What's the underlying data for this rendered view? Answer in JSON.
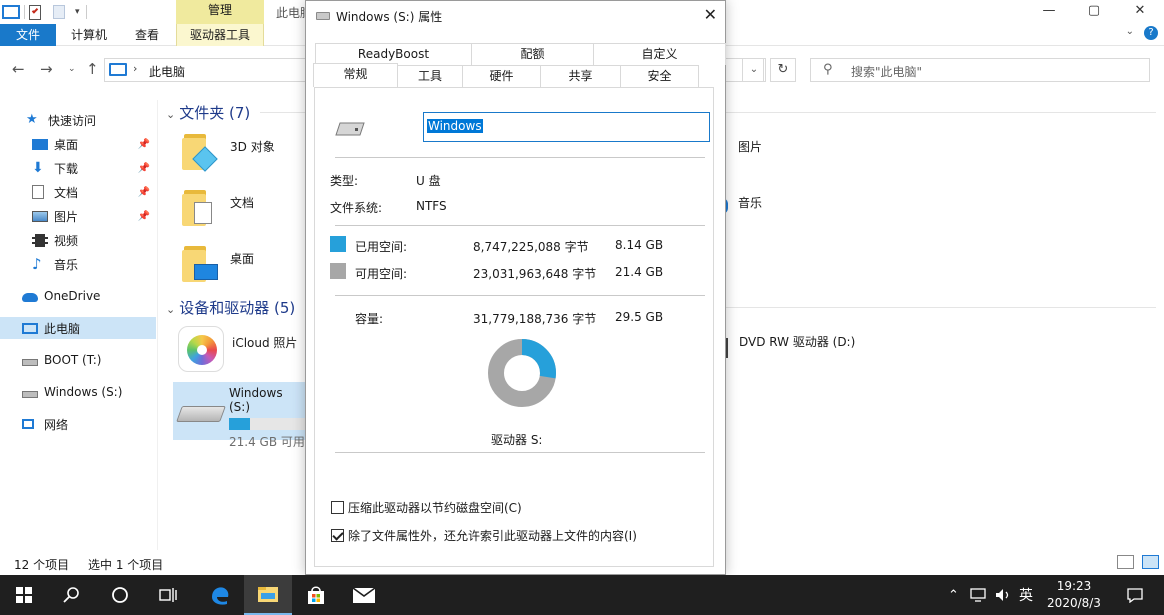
{
  "explorer": {
    "title_partial": "此电脑",
    "ribbon": {
      "manage_label": "管理",
      "tabs": [
        {
          "label": "文件"
        },
        {
          "label": "计算机"
        },
        {
          "label": "查看"
        },
        {
          "label": "驱动器工具"
        }
      ]
    },
    "window_controls": {
      "minimize": "—",
      "maximize": "▢",
      "close": "✕"
    },
    "address": {
      "path": "此电脑",
      "search_placeholder": "搜索\"此电脑\""
    },
    "sidebar": {
      "items": [
        {
          "label": "快速访问",
          "icon": "star-icon"
        },
        {
          "label": "桌面",
          "icon": "desktop-icon",
          "pinned": true
        },
        {
          "label": "下载",
          "icon": "download-icon",
          "pinned": true
        },
        {
          "label": "文档",
          "icon": "document-icon",
          "pinned": true
        },
        {
          "label": "图片",
          "icon": "picture-icon",
          "pinned": true
        },
        {
          "label": "视频",
          "icon": "video-icon"
        },
        {
          "label": "音乐",
          "icon": "music-icon"
        },
        {
          "label": "OneDrive",
          "icon": "cloud-icon"
        },
        {
          "label": "此电脑",
          "icon": "computer-icon",
          "selected": true
        },
        {
          "label": "BOOT (T:)",
          "icon": "usb-drive-icon"
        },
        {
          "label": "Windows (S:)",
          "icon": "usb-drive-icon"
        },
        {
          "label": "网络",
          "icon": "network-icon"
        }
      ]
    },
    "content": {
      "folders_header": "文件夹 (7)",
      "folders": [
        {
          "label": "3D 对象"
        },
        {
          "label": "文档"
        },
        {
          "label": "桌面"
        },
        {
          "label": "图片"
        },
        {
          "label": "音乐"
        }
      ],
      "devices_header": "设备和驱动器 (5)",
      "devices": [
        {
          "label": "iCloud 照片"
        },
        {
          "label": "Windows (S:)",
          "sub": "21.4 GB 可用",
          "used_fraction": 0.276
        },
        {
          "label": "DVD RW 驱动器 (D:)"
        }
      ]
    },
    "status": {
      "count": "12 个项目",
      "selected": "选中 1 个项目"
    }
  },
  "dialog": {
    "title": "Windows (S:) 属性",
    "close": "✕",
    "tabs_top": [
      "ReadyBoost",
      "配额",
      "自定义"
    ],
    "tabs_bottom": [
      "常规",
      "工具",
      "硬件",
      "共享",
      "安全"
    ],
    "active_tab": "常规",
    "name_value": "Windows",
    "type_label": "类型:",
    "type_value": "U 盘",
    "fs_label": "文件系统:",
    "fs_value": "NTFS",
    "used_label": "已用空间:",
    "used_bytes": "8,747,225,088 字节",
    "used_gb": "8.14 GB",
    "free_label": "可用空间:",
    "free_bytes": "23,031,963,648 字节",
    "free_gb": "21.4 GB",
    "cap_label": "容量:",
    "cap_bytes": "31,779,188,736 字节",
    "cap_gb": "29.5 GB",
    "drive_label": "驱动器 S:",
    "compress_label": "压缩此驱动器以节约磁盘空间(C)",
    "compress_checked": false,
    "index_label": "除了文件属性外，还允许索引此驱动器上文件的内容(I)",
    "index_checked": true,
    "colors": {
      "used": "#26a0da",
      "free": "#a7a7a7"
    },
    "usage_fraction": 0.2752
  },
  "taskbar": {
    "time": "19:23",
    "date": "2020/8/3",
    "ime": "英",
    "apps": [
      {
        "icon": "windows-start-icon"
      },
      {
        "icon": "search-icon"
      },
      {
        "icon": "cortana-icon"
      },
      {
        "icon": "task-view-icon"
      },
      {
        "icon": "edge-icon"
      },
      {
        "icon": "file-explorer-icon",
        "active": true
      },
      {
        "icon": "store-icon"
      },
      {
        "icon": "mail-icon"
      }
    ]
  }
}
